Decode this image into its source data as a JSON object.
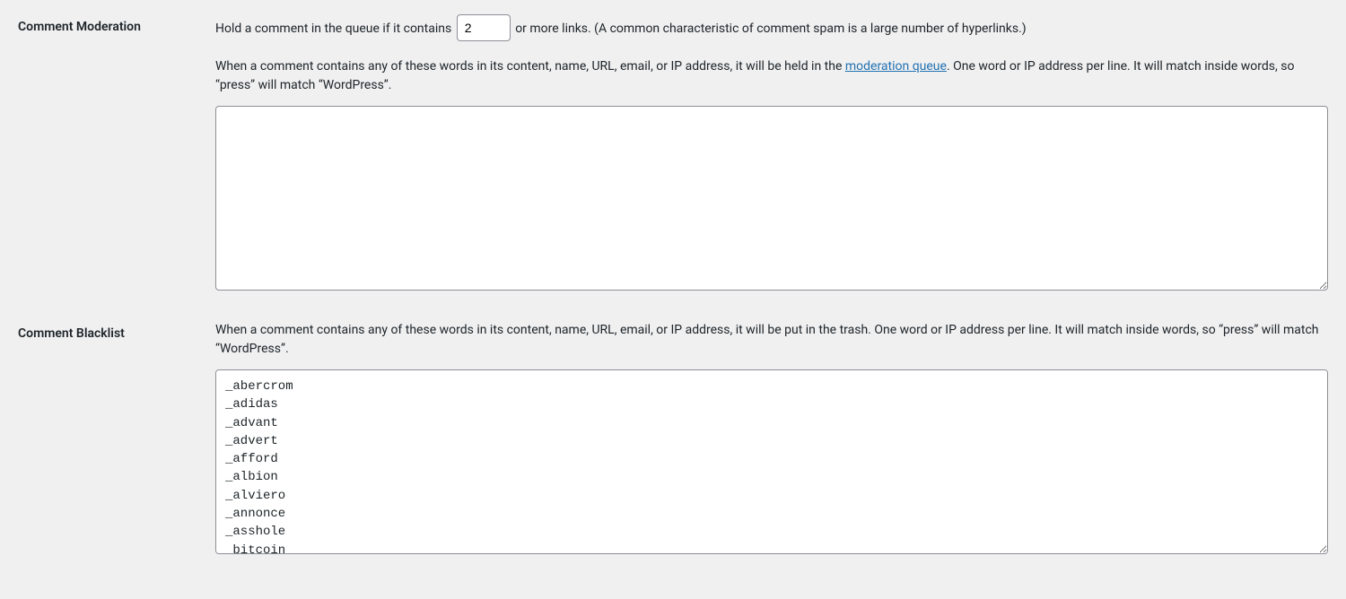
{
  "moderation": {
    "heading": "Comment Moderation",
    "line1_prefix": "Hold a comment in the queue if it contains",
    "links_value": "2",
    "line1_suffix": "or more links. (A common characteristic of comment spam is a large number of hyperlinks.)",
    "line2_prefix": "When a comment contains any of these words in its content, name, URL, email, or IP address, it will be held in the ",
    "link_text": "moderation queue",
    "line2_suffix": ". One word or IP address per line. It will match inside words, so “press” will match “WordPress”.",
    "textarea_value": ""
  },
  "blacklist": {
    "heading": "Comment Blacklist",
    "description": "When a comment contains any of these words in its content, name, URL, email, or IP address, it will be put in the trash. One word or IP address per line. It will match inside words, so “press” will match “WordPress”.",
    "textarea_value": "_abercrom\n_adidas\n_advant\n_advert\n_afford\n_albion\n_alviero\n_annonce\n_asshole\n_bitcoin"
  }
}
